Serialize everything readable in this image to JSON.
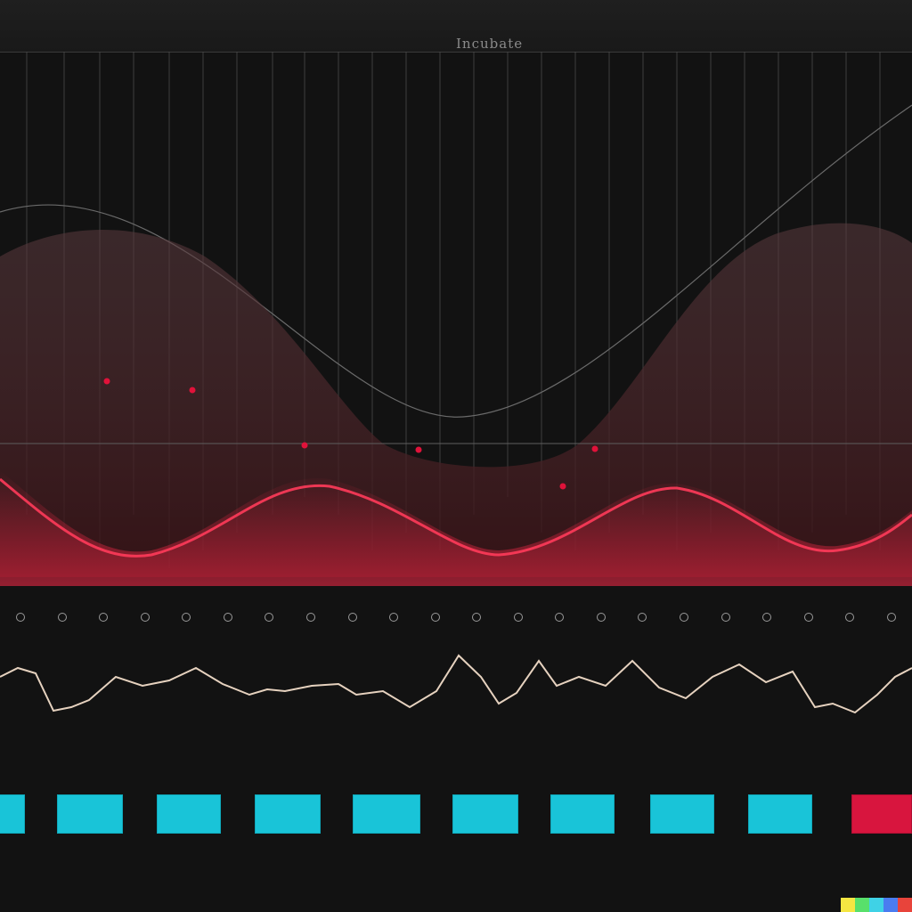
{
  "top_strip": {
    "title": "Incubate"
  },
  "marker_color": "#e0123a",
  "accent_color": "#19c4d8",
  "alert_color": "#d8153e",
  "panel_buttons": [
    {
      "label": "",
      "status": "normal"
    },
    {
      "label": "",
      "status": "normal"
    },
    {
      "label": "",
      "status": "normal"
    },
    {
      "label": "",
      "status": "normal"
    },
    {
      "label": "",
      "status": "normal"
    },
    {
      "label": "",
      "status": "normal"
    },
    {
      "label": "",
      "status": "normal"
    },
    {
      "label": "",
      "status": "normal"
    },
    {
      "label": "",
      "status": "normal"
    },
    {
      "label": "",
      "status": "alert"
    }
  ],
  "swatches": [
    "#f5e642",
    "#58e06b",
    "#3fd2e6",
    "#4a7cf0",
    "#e8443b"
  ]
}
